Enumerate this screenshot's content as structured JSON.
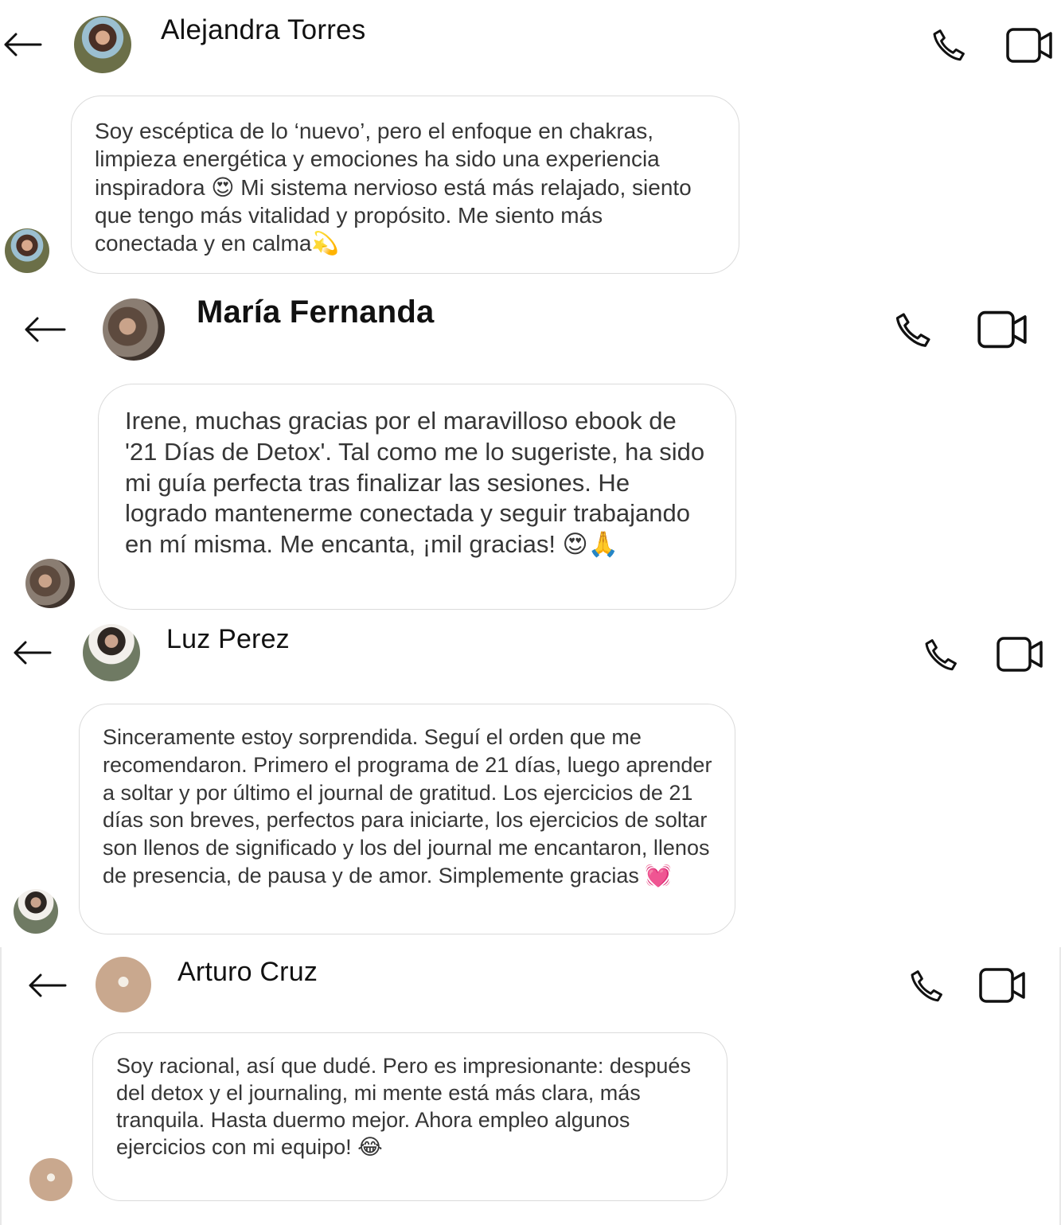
{
  "chats": [
    {
      "name": "Alejandra Torres",
      "message": "Soy escéptica de lo ‘nuevo’, pero el enfoque en chakras, limpieza energética y emociones ha sido una experiencia inspiradora 😍 Mi sistema nervioso está más relajado, siento que tengo más vitalidad y propósito. Me siento más conectada y en calma💫"
    },
    {
      "name": "María Fernanda",
      "message": "Irene, muchas gracias por el maravilloso ebook de '21 Días de Detox'. Tal como me lo sugeriste, ha sido mi guía perfecta tras finalizar las sesiones. He logrado mantenerme conectada y seguir trabajando en mí misma. Me encanta, ¡mil gracias! 😍🙏"
    },
    {
      "name": "Luz Perez",
      "message": "Sinceramente estoy sorprendida. Seguí el orden que me recomendaron. Primero el programa de 21 días, luego aprender a soltar y por último el journal de gratitud. Los ejercicios de 21 días son breves, perfectos para iniciarte, los ejercicios de soltar son llenos de significado y los del journal me encantaron, llenos de presencia, de pausa y de amor. Simplemente gracias 💓"
    },
    {
      "name": "Arturo Cruz",
      "message": "Soy racional, así que dudé. Pero es impresionante: después del detox y el journaling, mi mente está más clara, más tranquila. Hasta duermo mejor. Ahora empleo algunos ejercicios con mi equipo! 😂"
    }
  ],
  "icons": {
    "back": "arrow-left-icon",
    "call": "phone-icon",
    "video": "video-camera-icon"
  },
  "colors": {
    "background": "#ffffff",
    "bubble_border": "#dbdbdb",
    "text": "#262626"
  }
}
